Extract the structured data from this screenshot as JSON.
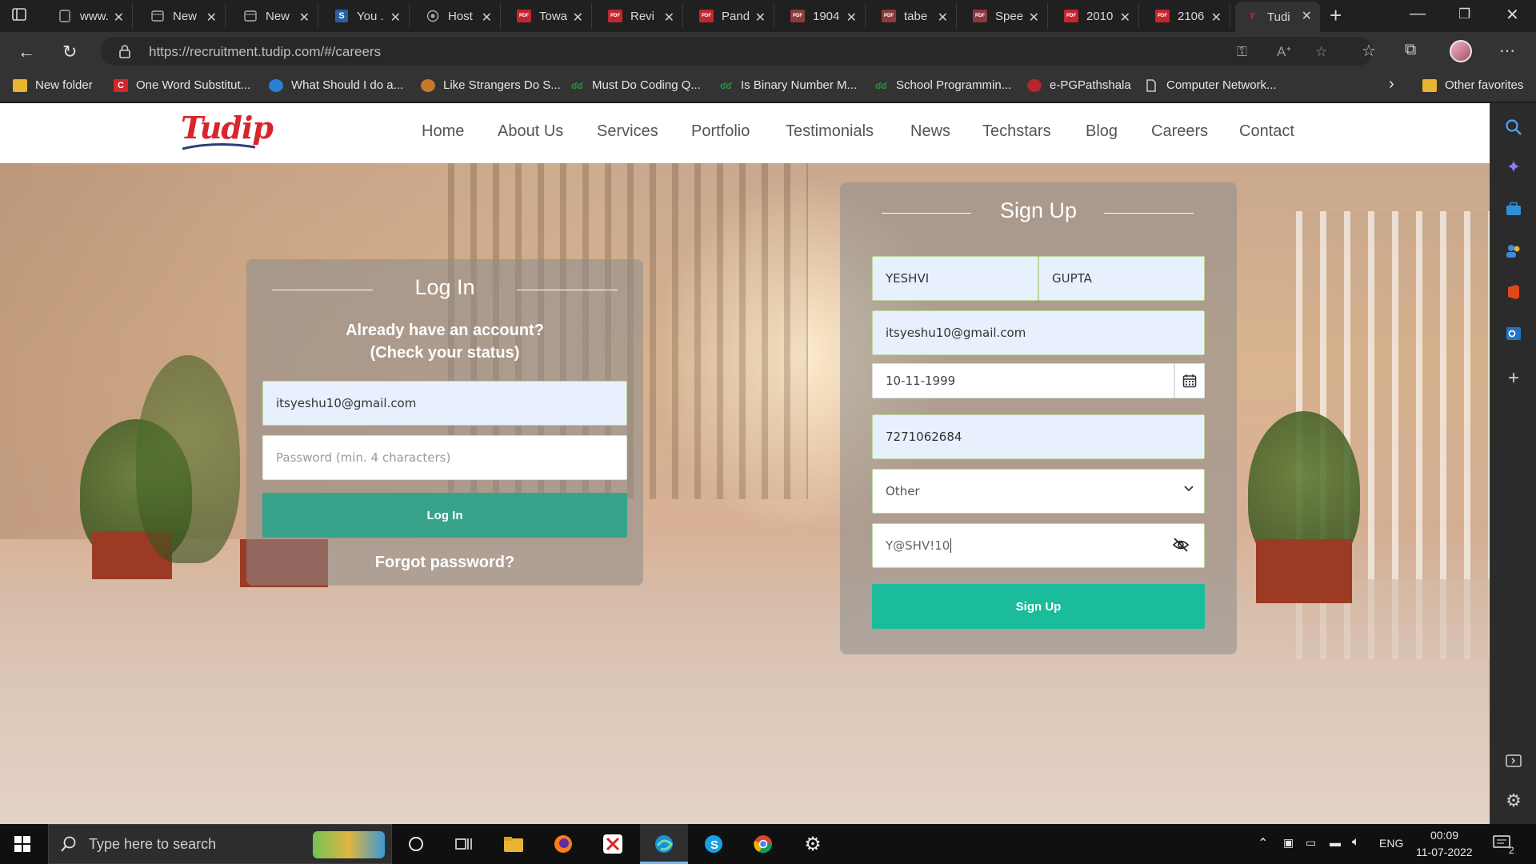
{
  "browser": {
    "tabs": [
      {
        "label": "www.",
        "icon": "page-icon"
      },
      {
        "label": "New",
        "icon": "page-icon"
      },
      {
        "label": "New",
        "icon": "page-icon"
      },
      {
        "label": "You .",
        "icon": "s-icon"
      },
      {
        "label": "Host",
        "icon": "globe-icon"
      },
      {
        "label": "Towa",
        "icon": "pdf-icon"
      },
      {
        "label": "Revi",
        "icon": "pdf-icon"
      },
      {
        "label": "Pand",
        "icon": "pdf-icon"
      },
      {
        "label": "1904",
        "icon": "pdf-icon"
      },
      {
        "label": "tabe",
        "icon": "pdf-icon"
      },
      {
        "label": "Spee",
        "icon": "pdf-icon"
      },
      {
        "label": "2010",
        "icon": "pdf-icon"
      },
      {
        "label": "2106",
        "icon": "pdf-icon"
      },
      {
        "label": "Tudi",
        "icon": "tudip-icon",
        "active": true
      }
    ],
    "url": "https://recruitment.tudip.com/#/careers",
    "bookmarks": [
      {
        "label": "New folder",
        "icon": "folder-icon"
      },
      {
        "label": "One Word Substitut...",
        "icon": "c-icon"
      },
      {
        "label": "What Should I do a...",
        "icon": "quill-icon"
      },
      {
        "label": "Like Strangers Do S...",
        "icon": "paw-icon"
      },
      {
        "label": "Must Do Coding Q...",
        "icon": "gfg-icon"
      },
      {
        "label": "Is Binary Number M...",
        "icon": "gfg-icon"
      },
      {
        "label": "School Programmin...",
        "icon": "gfg-icon"
      },
      {
        "label": "e-PGPathshala",
        "icon": "red-icon"
      },
      {
        "label": "Computer Network...",
        "icon": "doc-icon"
      }
    ],
    "other_favorites": "Other favorites"
  },
  "site": {
    "logo_text": "Tudip",
    "nav": [
      "Home",
      "About Us",
      "Services",
      "Portfolio",
      "Testimonials",
      "News",
      "Techstars",
      "Blog",
      "Careers",
      "Contact"
    ],
    "login": {
      "title": "Log In",
      "subtitle_line1": "Already have an account?",
      "subtitle_line2": "(Check your status)",
      "email_value": "itsyeshu10@gmail.com",
      "password_placeholder": "Password (min. 4 characters)",
      "button": "Log In",
      "forgot": "Forgot password?"
    },
    "signup": {
      "title": "Sign Up",
      "first_name": "YESHVI",
      "last_name": "GUPTA",
      "email": "itsyeshu10@gmail.com",
      "dob": "10-11-1999",
      "phone": "7271062684",
      "gender": "Other",
      "password": "Y@SHV!10",
      "button": "Sign Up"
    }
  },
  "taskbar": {
    "search_placeholder": "Type here to search",
    "language": "ENG",
    "time": "00:09",
    "date": "11-07-2022",
    "notification_count": "2"
  },
  "colors": {
    "brand_red": "#d7252c",
    "login_button": "#36a38a",
    "signup_button": "#1bbc9b"
  }
}
